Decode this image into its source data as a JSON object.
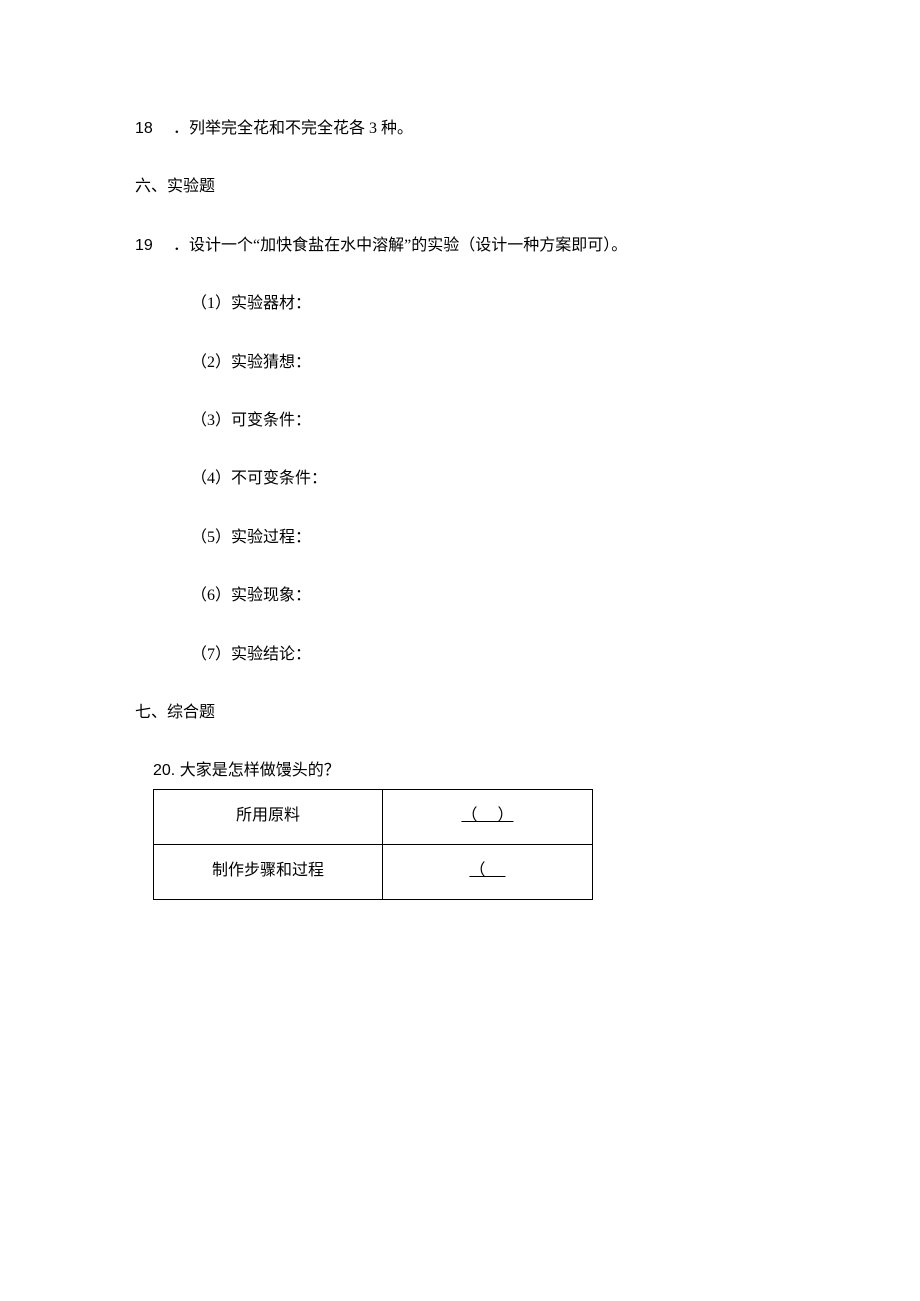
{
  "q18": {
    "num": "18",
    "sep": " ．",
    "text": "列举完全花和不完全花各 3 种。"
  },
  "section6": "六、实验题",
  "q19": {
    "num": "19",
    "sep": " ．",
    "text": "设计一个“加快食盐在水中溶解”的实验（设计一种方案即可）。",
    "items": [
      "（1）实验器材：",
      "（2）实验猜想：",
      "（3）可变条件：",
      "（4）不可变条件：",
      "（5）实验过程：",
      "（6）实验现象：",
      "（7）实验结论："
    ]
  },
  "section7": "七、综合题",
  "q20": {
    "num": "20. ",
    "text": "大家是怎样做馒头的？",
    "table": {
      "rows": [
        {
          "label": "所用原料",
          "blank": "（     ）"
        },
        {
          "label": "制作步骤和过程",
          "blank": "（     "
        }
      ]
    }
  }
}
